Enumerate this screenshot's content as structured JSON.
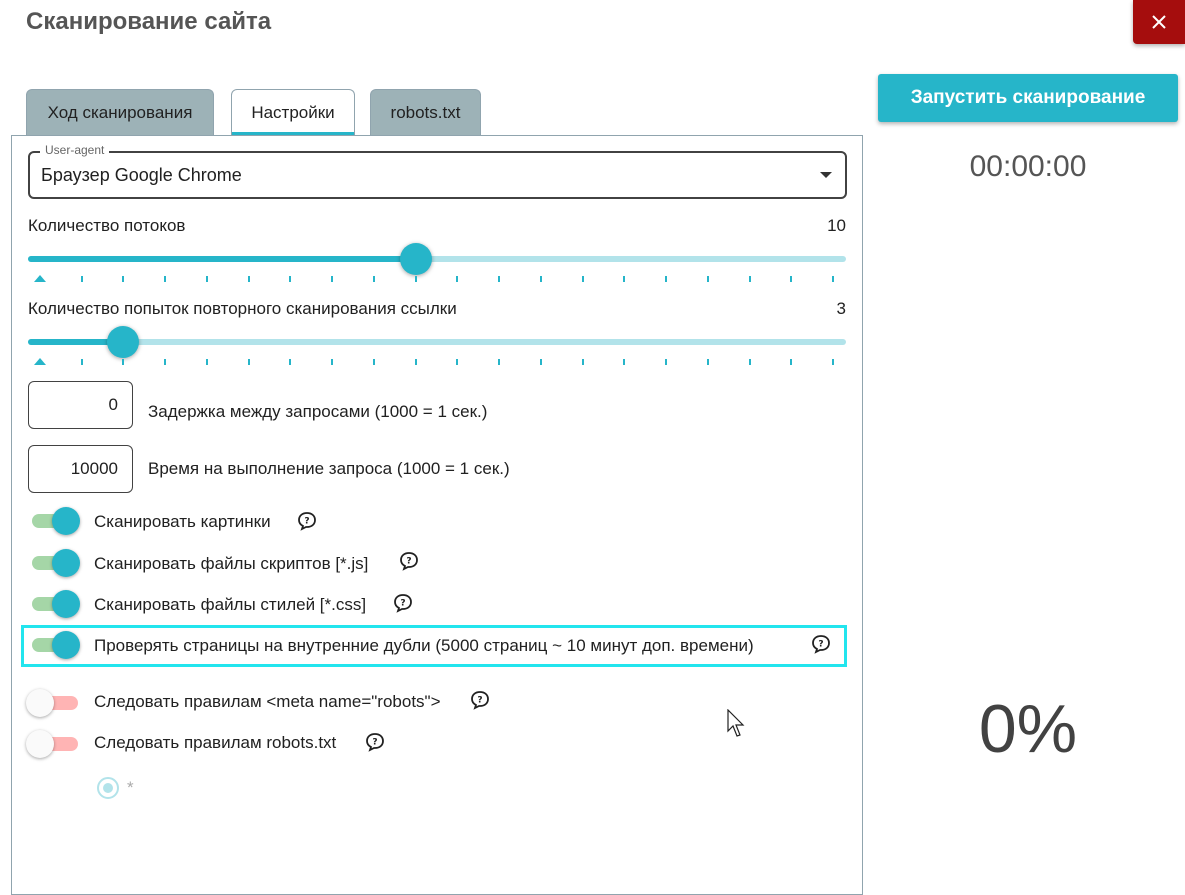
{
  "dialog": {
    "title": "Сканирование сайта"
  },
  "tabs": [
    {
      "label": "Ход сканирования"
    },
    {
      "label": "Настройки"
    },
    {
      "label": "robots.txt"
    }
  ],
  "settings": {
    "user_agent": {
      "legend": "User-agent",
      "value": "Браузер Google Chrome"
    },
    "threads": {
      "label": "Количество потоков",
      "value": "10",
      "min": 1,
      "max": 20,
      "current": 10
    },
    "retries": {
      "label": "Количество попыток повторного сканирования ссылки",
      "value": "3",
      "min": 1,
      "max": 20,
      "current": 3
    },
    "delay": {
      "value": "0",
      "label": "Задержка между запросами (1000 = 1 сек.)"
    },
    "timeout": {
      "value": "10000",
      "label": "Время на выполнение запроса (1000 = 1 сек.)"
    },
    "toggles": [
      {
        "label": "Сканировать картинки",
        "on": true
      },
      {
        "label": "Сканировать файлы скриптов [*.js]",
        "on": true
      },
      {
        "label": "Сканировать файлы стилей [*.css]",
        "on": true
      },
      {
        "label": "Проверять страницы на внутренние дубли (5000 страниц ~ 10 минут доп. времени)",
        "on": true
      },
      {
        "label": "Следовать правилам <meta name=\"robots\">",
        "on": false
      },
      {
        "label": "Следовать правилам robots.txt",
        "on": false
      }
    ],
    "robots_option": {
      "label": "*"
    }
  },
  "side": {
    "start_label": "Запустить сканирование",
    "timer": "00:00:00",
    "progress": "0%"
  },
  "icons": {
    "close": "close-icon",
    "help": "help-bubble-icon",
    "dropdown": "dropdown-arrow-icon"
  },
  "colors": {
    "accent": "#26b5c9",
    "close": "#a50d0d",
    "highlight": "#22e5ee",
    "tab_inactive": "#9db2b7"
  }
}
